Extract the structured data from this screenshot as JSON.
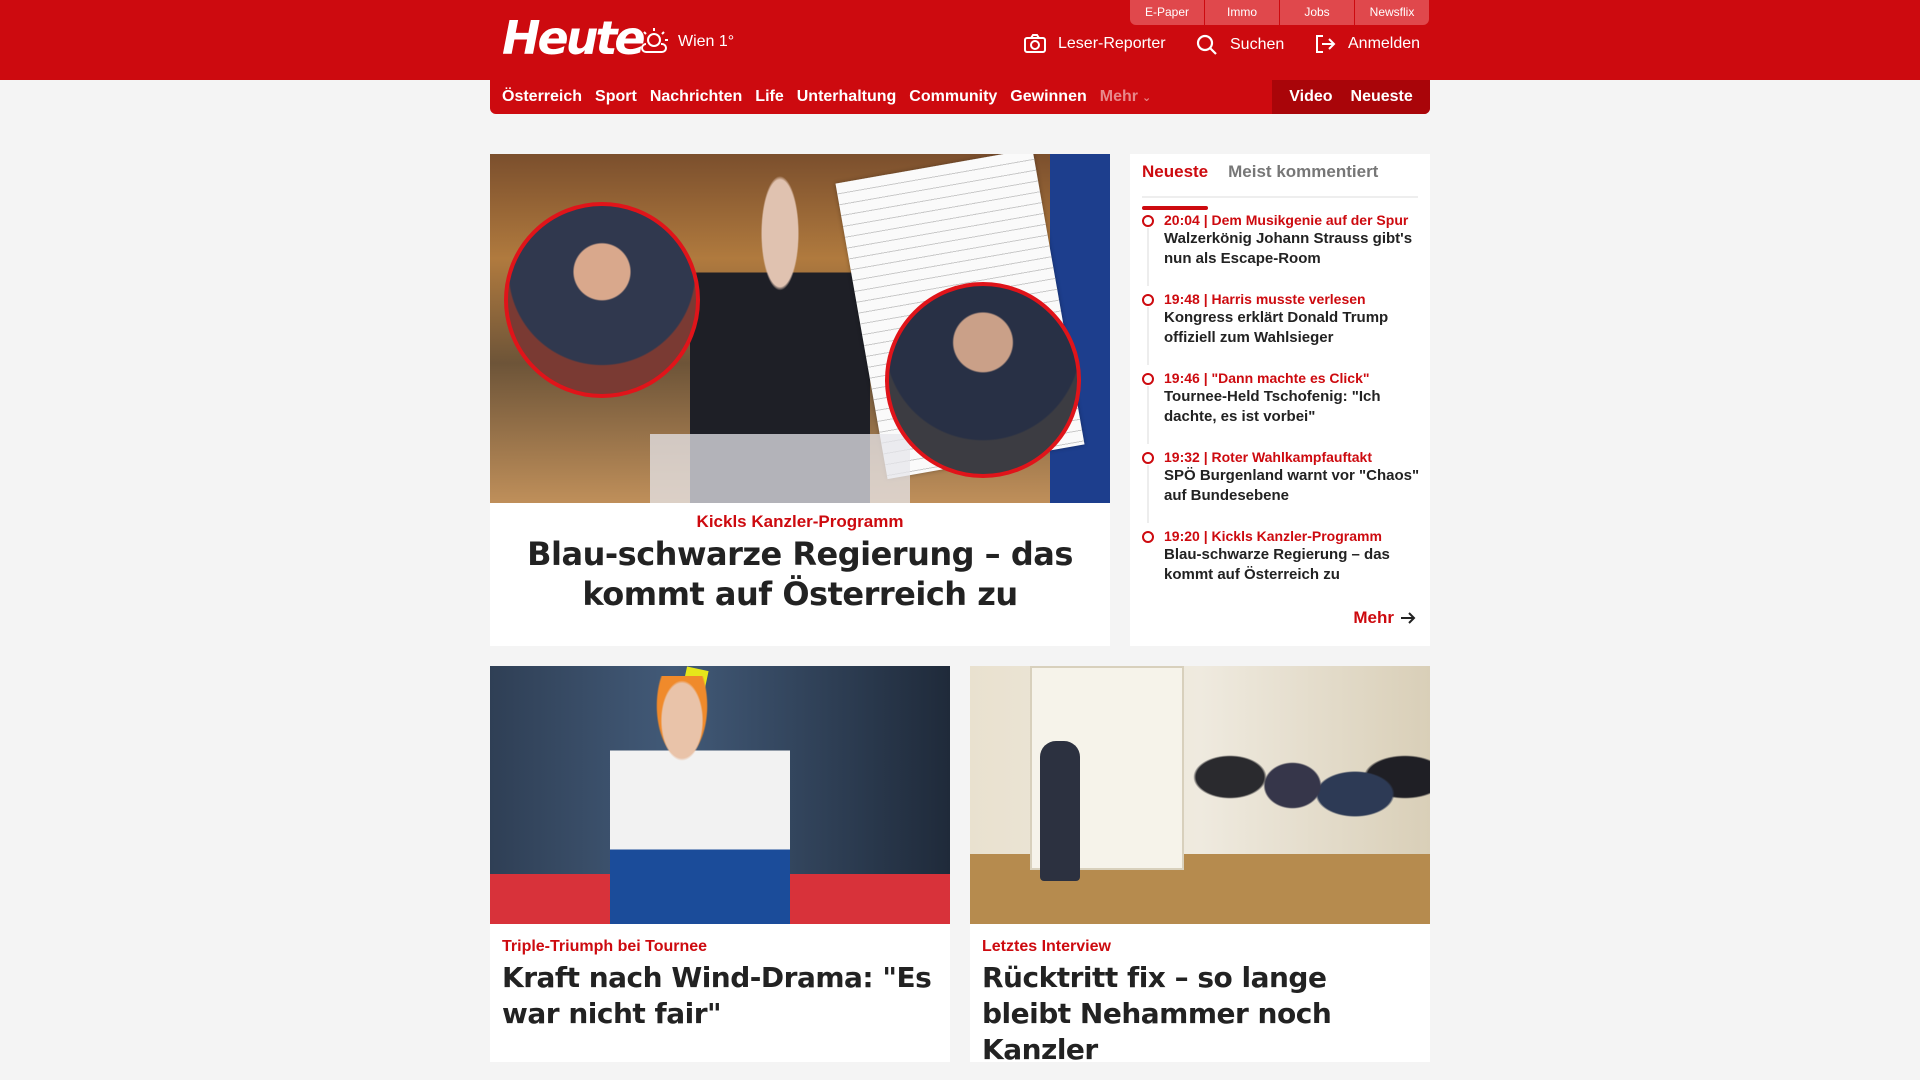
{
  "header": {
    "logo": "Heute",
    "weather": "Wien 1°",
    "top_links": [
      "E-Paper",
      "Immo",
      "Jobs",
      "Newsflix"
    ],
    "actions": {
      "reporter": "Leser-Reporter",
      "search": "Suchen",
      "login": "Anmelden"
    },
    "brand_color": "#cd0a0f"
  },
  "nav": {
    "items": [
      "Österreich",
      "Sport",
      "Nachrichten",
      "Life",
      "Unterhaltung",
      "Community",
      "Gewinnen"
    ],
    "more": "Mehr",
    "right": [
      "Video",
      "Neueste"
    ]
  },
  "hero": {
    "kicker": "Kickls Kanzler-Programm",
    "title": "Blau-schwarze Regierung – das kommt auf Österreich zu"
  },
  "newest": {
    "tabs": [
      "Neueste",
      "Meist kommentiert"
    ],
    "items": [
      {
        "meta": "20:04 | Dem Musikgenie auf der Spur",
        "title": "Walzerkönig Johann Strauss gibt's nun als Escape-Room"
      },
      {
        "meta": "19:48 | Harris musste verlesen",
        "title": "Kongress erklärt Donald Trump offiziell zum Wahlsieger"
      },
      {
        "meta": "19:46 | \"Dann machte es Click\"",
        "title": "Tournee-Held Tschofenig: \"Ich dachte, es ist vorbei\""
      },
      {
        "meta": "19:32 | Roter Wahlkampfauftakt",
        "title": "SPÖ Burgenland warnt vor \"Chaos\" auf Bundesebene"
      },
      {
        "meta": "19:20 | Kickls Kanzler-Programm",
        "title": "Blau-schwarze Regierung – das kommt auf Österreich zu"
      }
    ],
    "more": "Mehr"
  },
  "cards": [
    {
      "kicker": "Triple-Triumph bei Tournee",
      "title": "Kraft nach Wind-Drama: \"Es war nicht fair\""
    },
    {
      "kicker": "Letztes Interview",
      "title": "Rücktritt fix – so lange bleibt Nehammer noch Kanzler"
    }
  ]
}
